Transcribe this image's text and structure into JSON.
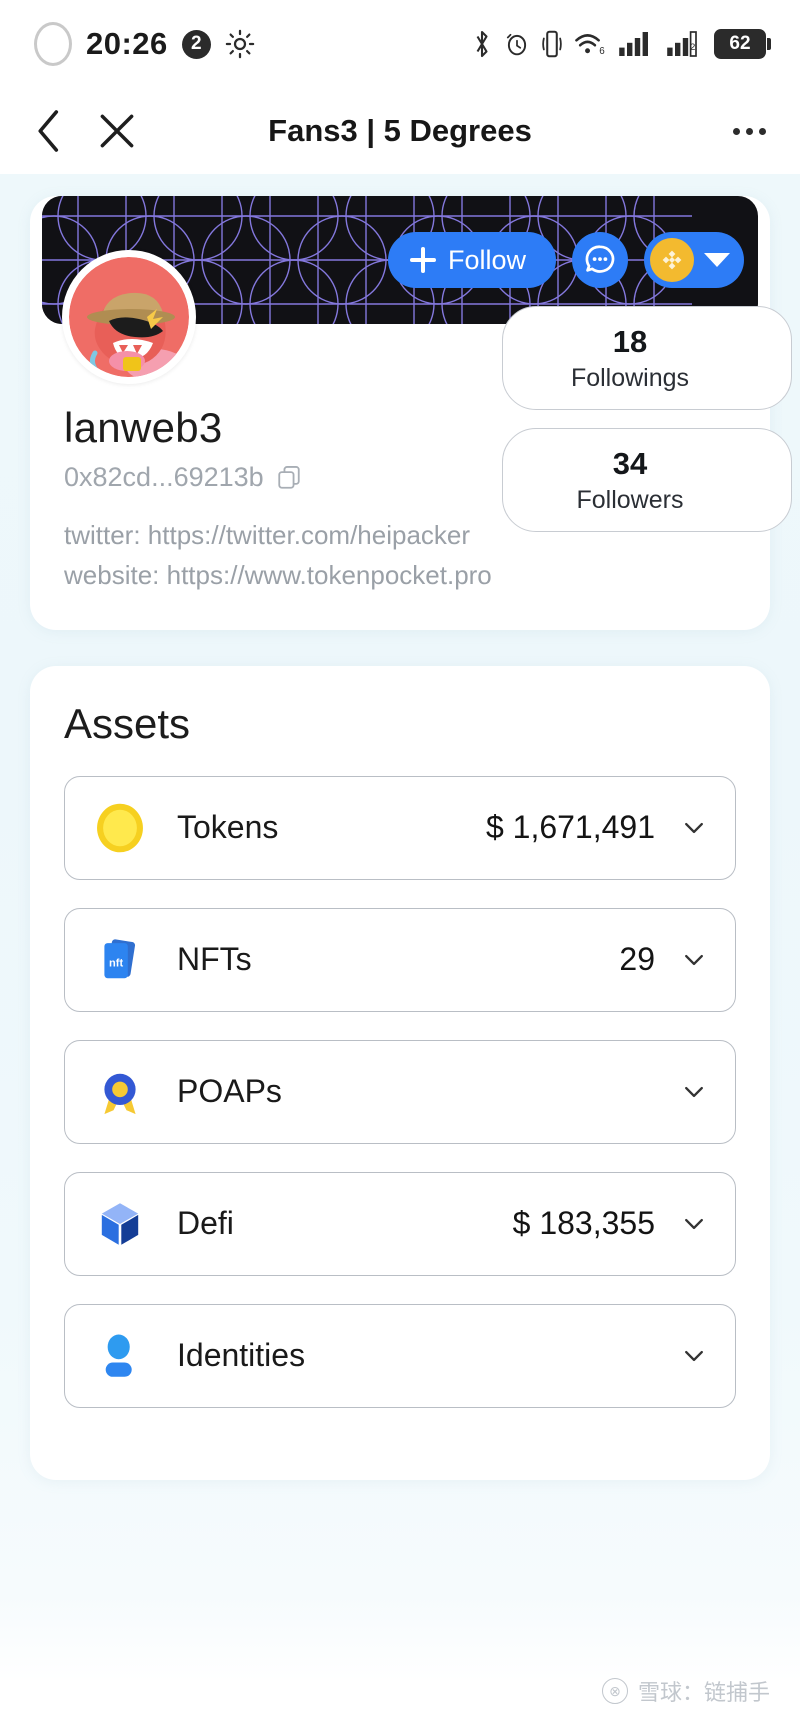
{
  "statusbar": {
    "time": "20:26",
    "notification_count": "2",
    "battery_level": "62",
    "icons_left": [
      "recording-ring-icon",
      "brightness-icon"
    ],
    "icons_right": [
      "bluetooth-icon",
      "alarm-icon",
      "vibrate-icon",
      "wifi6-icon",
      "signal-icon-1",
      "signal-icon-2",
      "battery-icon"
    ]
  },
  "navbar": {
    "title": "Fans3 | 5 Degrees",
    "back_icon": "chevron-left-icon",
    "close_icon": "close-icon",
    "more_icon": "more-horizontal-icon"
  },
  "profile": {
    "username": "lanweb3",
    "address": "0x82cd...69213b",
    "copy_icon": "copy-icon",
    "follow_label": "Follow",
    "chat_icon": "chat-bubble-icon",
    "chain_icon": "bnb-chain-icon",
    "chain_caret": "caret-down-icon",
    "links": [
      "twitter: https://twitter.com/heipacker",
      "website: https://www.tokenpocket.pro"
    ],
    "stats": [
      {
        "value": "18",
        "label": "Followings"
      },
      {
        "value": "34",
        "label": "Followers"
      }
    ]
  },
  "assets": {
    "title": "Assets",
    "rows": [
      {
        "icon": "token-coin-icon",
        "label": "Tokens",
        "value": "$ 1,671,491",
        "chevron": "chevron-down-icon"
      },
      {
        "icon": "nft-cards-icon",
        "label": "NFTs",
        "value": "29",
        "chevron": "chevron-down-icon"
      },
      {
        "icon": "poap-medal-icon",
        "label": "POAPs",
        "value": "",
        "chevron": "chevron-down-icon"
      },
      {
        "icon": "defi-cube-icon",
        "label": "Defi",
        "value": "$ 183,355",
        "chevron": "chevron-down-icon"
      },
      {
        "icon": "identity-person-icon",
        "label": "Identities",
        "value": "",
        "chevron": "chevron-down-icon"
      }
    ]
  },
  "watermark": {
    "text": "雪球：链捕手",
    "logo_icon": "xueqiu-logo-icon"
  },
  "colors": {
    "accent_blue": "#2d7cf6",
    "bnb_gold": "#f3ba2f",
    "banner_dark": "#111115",
    "banner_grid": "#7b6fe0",
    "page_bg": "#edf7fb"
  }
}
